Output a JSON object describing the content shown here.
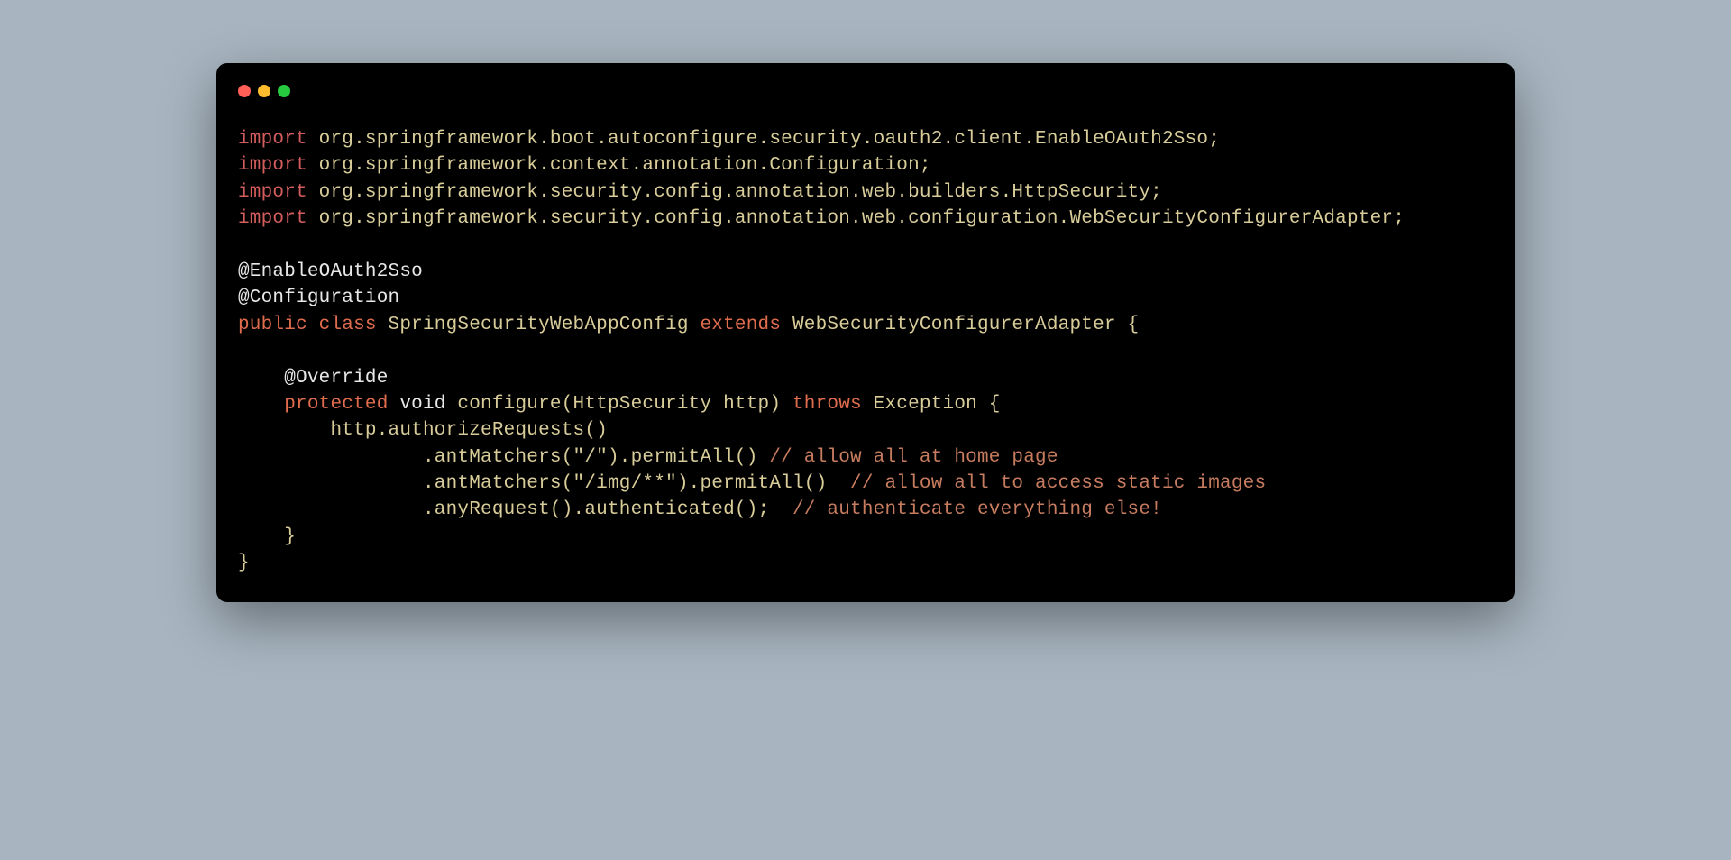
{
  "colors": {
    "keyword": "#d35c5c",
    "keyword_bright": "#e06c4e",
    "identifier": "#d8cc99",
    "plain": "#e8e8e8",
    "comment": "#c77c5f",
    "background": "#000000",
    "page_bg": "#a8b5c0"
  },
  "window_controls": {
    "close": "red",
    "minimize": "yellow",
    "maximize": "green"
  },
  "code": {
    "l1_import": "import",
    "l1_rest": " org.springframework.boot.autoconfigure.security.oauth2.client.EnableOAuth2Sso;",
    "l2_import": "import",
    "l2_rest": " org.springframework.context.annotation.Configuration;",
    "l3_import": "import",
    "l3_rest": " org.springframework.security.config.annotation.web.builders.HttpSecurity;",
    "l4_import": "import",
    "l4_rest": " org.springframework.security.config.annotation.web.configuration.WebSecurityConfigurerAdapter;",
    "blank1": "",
    "l6_anno": "@EnableOAuth2Sso",
    "l7_anno": "@Configuration",
    "l8_public": "public",
    "l8_class": " class",
    "l8_name": " SpringSecurityWebAppConfig ",
    "l8_extends": "extends",
    "l8_parent": " WebSecurityConfigurerAdapter {",
    "blank2": "",
    "l10_override": "    @Override",
    "l11_protected": "    protected",
    "l11_void": " void",
    "l11_method": " configure(HttpSecurity http) ",
    "l11_throws": "throws",
    "l11_exc": " Exception {",
    "l12": "        http.authorizeRequests()",
    "l13_code": "                .antMatchers(\"/\").permitAll() ",
    "l13_comment": "// allow all at home page",
    "l14_code": "                .antMatchers(\"/img/**\").permitAll()  ",
    "l14_comment": "// allow all to access static images",
    "l15_code": "                .anyRequest().authenticated();  ",
    "l15_comment": "// authenticate everything else!",
    "l16": "    }",
    "l17": "}"
  }
}
